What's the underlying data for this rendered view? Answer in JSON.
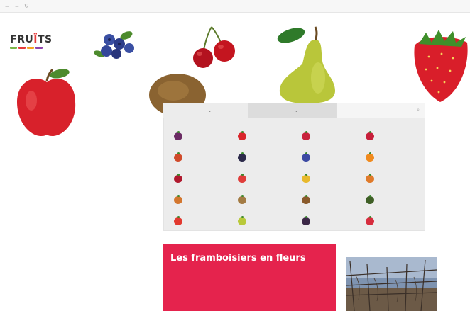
{
  "browser": {
    "back": "←",
    "forward": "→",
    "reload": "↻"
  },
  "logo": {
    "word_start": "FRU",
    "word_i": "Ï",
    "word_end": "TS",
    "colors": [
      "#7ab648",
      "#e63b3b",
      "#f5a623",
      "#8e44ad"
    ]
  },
  "nav": {
    "items": [],
    "right": ""
  },
  "tabs": {
    "tab1": "",
    "tab2": "",
    "search_placeholder": "",
    "caret_icon": "chevron-down-icon",
    "search_icon": "search-icon"
  },
  "fruit_grid": [
    {
      "color": "#6a2b63",
      "label": ""
    },
    {
      "color": "#d9262b",
      "label": ""
    },
    {
      "color": "#c8243c",
      "label": ""
    },
    {
      "color": "#c71f3a",
      "label": ""
    },
    {
      "color": "#d04a2a",
      "label": ""
    },
    {
      "color": "#2c2a4a",
      "label": ""
    },
    {
      "color": "#3c4aa3",
      "label": ""
    },
    {
      "color": "#f08a1d",
      "label": ""
    },
    {
      "color": "#b0192e",
      "label": ""
    },
    {
      "color": "#e03d3a",
      "label": ""
    },
    {
      "color": "#e8b92c",
      "label": ""
    },
    {
      "color": "#e07a2a",
      "label": ""
    },
    {
      "color": "#d3762e",
      "label": ""
    },
    {
      "color": "#a37b43",
      "label": ""
    },
    {
      "color": "#8a5a2b",
      "label": ""
    },
    {
      "color": "#3f5f26",
      "label": ""
    },
    {
      "color": "#e2392f",
      "label": ""
    },
    {
      "color": "#b9c93a",
      "label": ""
    },
    {
      "color": "#3b2746",
      "label": ""
    },
    {
      "color": "#d72d3e",
      "label": ""
    }
  ],
  "promo": {
    "kicker": "",
    "title": "Les framboisiers en fleurs",
    "body": ""
  },
  "side": {
    "label": ""
  },
  "accent": "#e5234d"
}
